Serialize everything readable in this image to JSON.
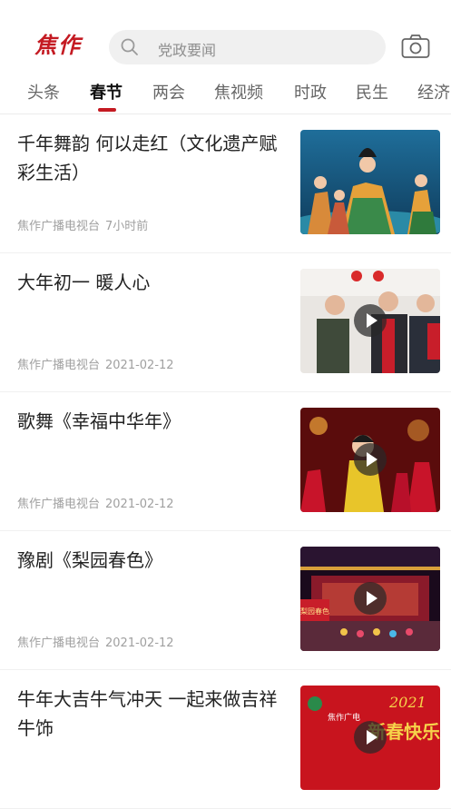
{
  "header": {
    "logo": "焦作",
    "search_placeholder": "党政要闻"
  },
  "tabs": [
    {
      "label": "头条"
    },
    {
      "label": "春节"
    },
    {
      "label": "两会"
    },
    {
      "label": "焦视频"
    },
    {
      "label": "时政"
    },
    {
      "label": "民生"
    },
    {
      "label": "经济"
    }
  ],
  "active_tab": "春节",
  "news": [
    {
      "title": "千年舞韵 何以走红（文化遗产赋彩生活）",
      "source": "焦作广播电视台",
      "time": "7小时前",
      "has_video": false
    },
    {
      "title": "大年初一 暖人心",
      "source": "焦作广播电视台",
      "time": "2021-02-12",
      "has_video": true
    },
    {
      "title": "歌舞《幸福中华年》",
      "source": "焦作广播电视台",
      "time": "2021-02-12",
      "has_video": true
    },
    {
      "title": "豫剧《梨园春色》",
      "source": "焦作广播电视台",
      "time": "2021-02-12",
      "has_video": true
    },
    {
      "title": "牛年大吉牛气冲天 一起来做吉祥牛饰",
      "source": "",
      "time": "",
      "has_video": true
    }
  ],
  "thumb_text": {
    "item4_banner": "梨园春色",
    "item5_brand": "焦作广电",
    "item5_year": "2021",
    "item5_greeting": "新春快乐"
  },
  "colors": {
    "accent": "#c41a22"
  }
}
